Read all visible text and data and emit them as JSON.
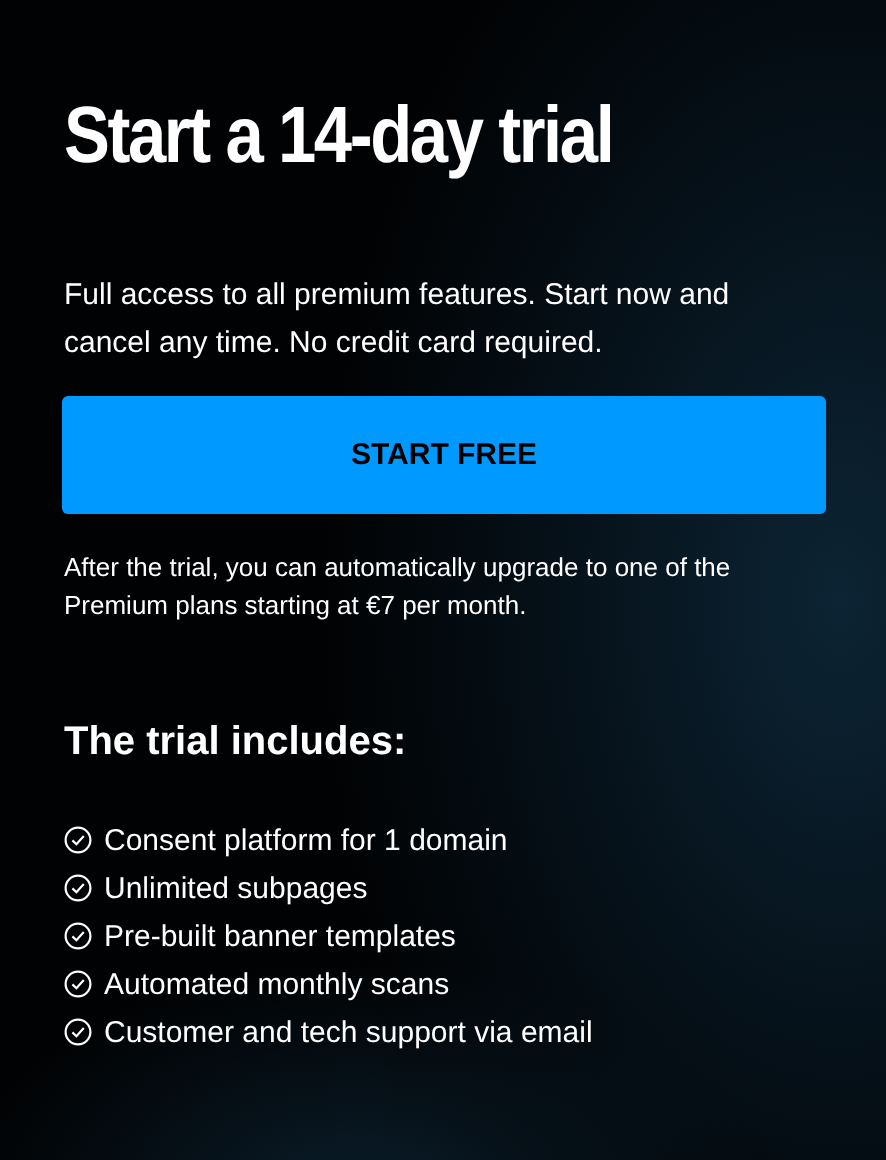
{
  "title": "Start a 14-day trial",
  "intro": "Full access to all premium features. Start now and cancel any time. No credit card required.",
  "button": "START FREE",
  "note": "After the trial, you can automatically upgrade to one of the Premium plans starting at €7 per month.",
  "includes_heading": "The trial includes:",
  "features": [
    "Consent platform for 1 domain",
    "Unlimited subpages",
    "Pre-built banner templates",
    "Automated monthly scans",
    "Customer and tech support via email"
  ]
}
